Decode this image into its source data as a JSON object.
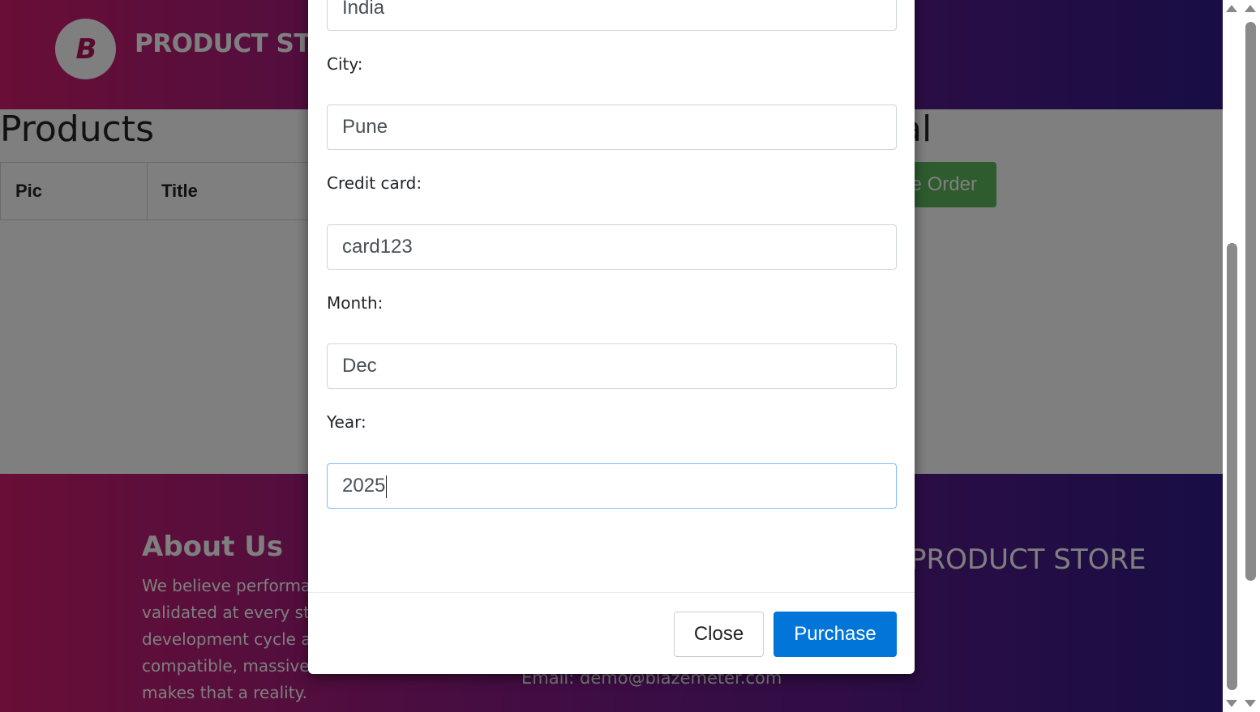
{
  "navbar": {
    "brand": "PRODUCT STORE",
    "logo_letter": "B"
  },
  "cart": {
    "products_title": "Products",
    "total_title_fragment": "al",
    "columns": [
      "Pic",
      "Title"
    ],
    "place_order_fragment": "e Order"
  },
  "footer": {
    "about_title": "About Us",
    "about_lines": [
      "We believe performance needs to be",
      "validated at every stage of the software",
      "development cycle and our open source",
      "compatible, massively scalable platform",
      "makes that a reality."
    ],
    "brand": "PRODUCT STORE",
    "email": "Email: demo@blazemeter.com"
  },
  "modal": {
    "country_value": "India",
    "city_label": "City:",
    "city_value": "Pune",
    "card_label": "Credit card:",
    "card_value": "card123",
    "month_label": "Month:",
    "month_value": "Dec",
    "year_label": "Year:",
    "year_value": "2025",
    "close_label": "Close",
    "purchase_label": "Purchase"
  },
  "colors": {
    "purchase_button": "#0275d8",
    "place_order_button": "#5cb85c",
    "header_gradient_start": "#d11d6e",
    "header_gradient_end": "#311a8a"
  }
}
